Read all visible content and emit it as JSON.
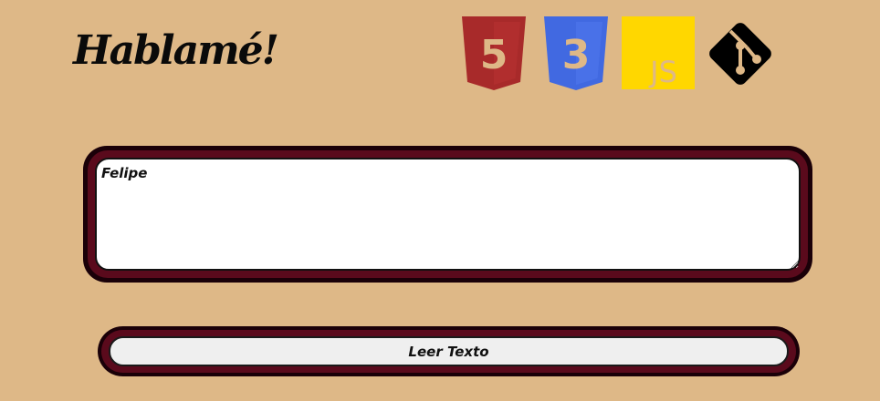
{
  "header": {
    "title": "Hablamé!"
  },
  "tech_icons": [
    {
      "name": "html5-icon",
      "label": "5",
      "color": "#a82a2a"
    },
    {
      "name": "css3-icon",
      "label": "3",
      "color": "#4169e1"
    },
    {
      "name": "js-icon",
      "label": "JS",
      "color": "#ffd700"
    },
    {
      "name": "git-icon",
      "label": "",
      "color": "#000000"
    }
  ],
  "textarea": {
    "value": "Felipe"
  },
  "read_button": {
    "label": "Leer Texto"
  },
  "colors": {
    "background": "#deb887",
    "frame_outer": "#1a0008",
    "frame_inner": "#5a0a1c"
  }
}
